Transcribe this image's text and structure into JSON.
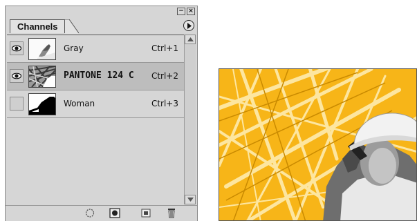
{
  "palette": {
    "window_buttons": {
      "minimize": "−",
      "close": "×"
    },
    "tab_label": "Channels",
    "menu_icon": "palette-menu-arrow-icon",
    "channels": [
      {
        "name": "Gray",
        "shortcut": "Ctrl+1",
        "visible": true,
        "selected": false
      },
      {
        "name": "PANTONE 124 C",
        "shortcut": "Ctrl+2",
        "visible": true,
        "selected": true
      },
      {
        "name": "Woman",
        "shortcut": "Ctrl+3",
        "visible": false,
        "selected": false
      }
    ],
    "bottom_icons": [
      "load-selection-icon",
      "save-selection-icon",
      "new-channel-icon",
      "delete-channel-icon"
    ]
  },
  "colors": {
    "spot": "#f7b518",
    "panel": "#d6d6d6",
    "selected_row": "#bdbdbd"
  }
}
